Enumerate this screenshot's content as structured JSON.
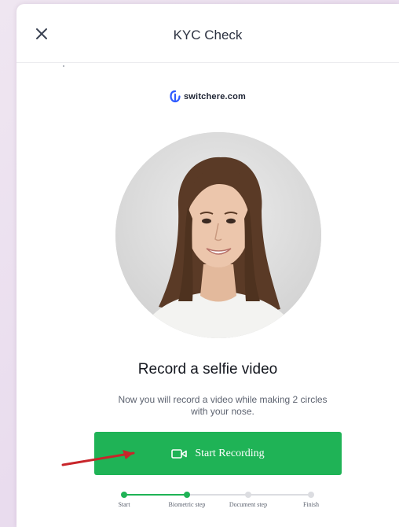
{
  "header": {
    "title": "KYC Check",
    "close_icon": "close-icon"
  },
  "brand": {
    "name": "switchere.com",
    "icon": "switchere-logo-icon",
    "color": "#2f5bff"
  },
  "main": {
    "headline": "Record a selfie video",
    "description": "Now you will record a video while making 2 circles with your nose.",
    "record_button": {
      "label": "Start Recording",
      "icon": "video-camera-icon",
      "color": "#1fb356"
    }
  },
  "progress": {
    "steps": [
      {
        "label": "Start",
        "completed": true
      },
      {
        "label": "Biometric step",
        "completed": true
      },
      {
        "label": "Document step",
        "completed": false
      },
      {
        "label": "Finish",
        "completed": false
      }
    ],
    "active_color": "#1fb356",
    "inactive_color": "#dcdde1"
  },
  "annotation": {
    "arrow_color": "#c8252a"
  }
}
